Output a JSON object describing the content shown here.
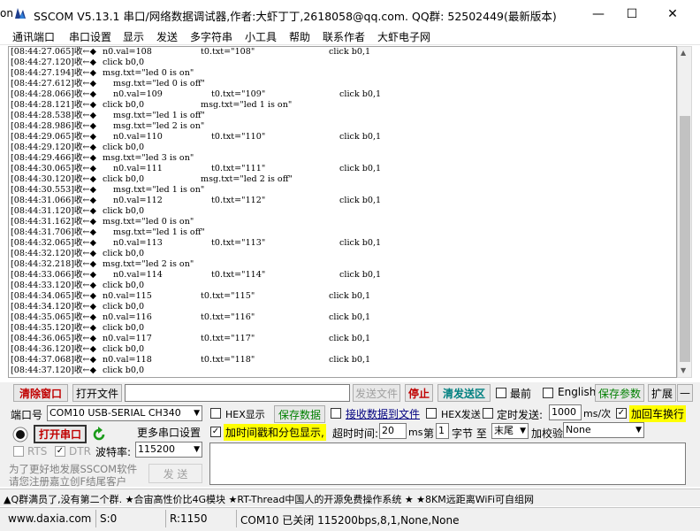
{
  "window": {
    "edge_text": "on",
    "title": "SSCOM V5.13.1 串口/网络数据调试器,作者:大虾丁丁,2618058@qq.com. QQ群: 52502449(最新版本)",
    "controls": {
      "minimize": "—",
      "maximize": "☐",
      "close": "✕"
    }
  },
  "menu": [
    "通讯端口",
    "串口设置",
    "显示",
    "发送",
    "多字符串",
    "小工具",
    "帮助",
    "联系作者",
    "大虾电子网"
  ],
  "log": [
    {
      "t": "[08:44:27.065]收←◆",
      "a": "n0.val=108",
      "b": "t0.txt=\"108\"",
      "c": "click b0,1",
      "ind": 0
    },
    {
      "t": "[08:44:27.120]收←◆",
      "a": "click b0,0",
      "b": "",
      "c": "",
      "ind": 0
    },
    {
      "t": "[08:44:27.194]收←◆",
      "a": "msg.txt=\"led 0 is on\"",
      "b": "",
      "c": "",
      "ind": 0
    },
    {
      "t": "[08:44:27.612]收←◆",
      "a": "msg.txt=\"led 0 is off\"",
      "b": "",
      "c": "",
      "ind": 1
    },
    {
      "t": "[08:44:28.066]收←◆",
      "a": "n0.val=109",
      "b": "t0.txt=\"109\"",
      "c": "click b0,1",
      "ind": 1
    },
    {
      "t": "[08:44:28.121]收←◆",
      "a": "click b0,0",
      "b": "msg.txt=\"led 1 is on\"",
      "c": "",
      "ind": 0
    },
    {
      "t": "[08:44:28.538]收←◆",
      "a": "msg.txt=\"led 1 is off\"",
      "b": "",
      "c": "",
      "ind": 1
    },
    {
      "t": "[08:44:28.986]收←◆",
      "a": "msg.txt=\"led 2 is on\"",
      "b": "",
      "c": "",
      "ind": 1
    },
    {
      "t": "[08:44:29.065]收←◆",
      "a": "n0.val=110",
      "b": "t0.txt=\"110\"",
      "c": "click b0,1",
      "ind": 1
    },
    {
      "t": "[08:44:29.120]收←◆",
      "a": "click b0,0",
      "b": "",
      "c": "",
      "ind": 0
    },
    {
      "t": "[08:44:29.466]收←◆",
      "a": "msg.txt=\"led 3 is on\"",
      "b": "",
      "c": "",
      "ind": 0
    },
    {
      "t": "[08:44:30.065]收←◆",
      "a": "n0.val=111",
      "b": "t0.txt=\"111\"",
      "c": "click b0,1",
      "ind": 1
    },
    {
      "t": "[08:44:30.120]收←◆",
      "a": "click b0,0",
      "b": "msg.txt=\"led 2 is off\"",
      "c": "",
      "ind": 0
    },
    {
      "t": "[08:44:30.553]收←◆",
      "a": "msg.txt=\"led 1 is on\"",
      "b": "",
      "c": "",
      "ind": 1
    },
    {
      "t": "[08:44:31.066]收←◆",
      "a": "n0.val=112",
      "b": "t0.txt=\"112\"",
      "c": "click b0,1",
      "ind": 1
    },
    {
      "t": "[08:44:31.120]收←◆",
      "a": "click b0,0",
      "b": "",
      "c": "",
      "ind": 0
    },
    {
      "t": "[08:44:31.162]收←◆",
      "a": "msg.txt=\"led 0 is on\"",
      "b": "",
      "c": "",
      "ind": 0
    },
    {
      "t": "[08:44:31.706]收←◆",
      "a": "msg.txt=\"led 1 is off\"",
      "b": "",
      "c": "",
      "ind": 1
    },
    {
      "t": "[08:44:32.065]收←◆",
      "a": "n0.val=113",
      "b": "t0.txt=\"113\"",
      "c": "click b0,1",
      "ind": 1
    },
    {
      "t": "[08:44:32.120]收←◆",
      "a": "click b0,0",
      "b": "",
      "c": "",
      "ind": 0
    },
    {
      "t": "[08:44:32.218]收←◆",
      "a": "msg.txt=\"led 2 is on\"",
      "b": "",
      "c": "",
      "ind": 0
    },
    {
      "t": "[08:44:33.066]收←◆",
      "a": "n0.val=114",
      "b": "t0.txt=\"114\"",
      "c": "click b0,1",
      "ind": 1
    },
    {
      "t": "[08:44:33.120]收←◆",
      "a": "click b0,0",
      "b": "",
      "c": "",
      "ind": 0
    },
    {
      "t": "[08:44:34.065]收←◆",
      "a": "n0.val=115",
      "b": "t0.txt=\"115\"",
      "c": "click b0,1",
      "ind": 0
    },
    {
      "t": "[08:44:34.120]收←◆",
      "a": "click b0,0",
      "b": "",
      "c": "",
      "ind": 0
    },
    {
      "t": "[08:44:35.065]收←◆",
      "a": "n0.val=116",
      "b": "t0.txt=\"116\"",
      "c": "click b0,1",
      "ind": 0
    },
    {
      "t": "[08:44:35.120]收←◆",
      "a": "click b0,0",
      "b": "",
      "c": "",
      "ind": 0
    },
    {
      "t": "[08:44:36.065]收←◆",
      "a": "n0.val=117",
      "b": "t0.txt=\"117\"",
      "c": "click b0,1",
      "ind": 0
    },
    {
      "t": "[08:44:36.120]收←◆",
      "a": "click b0,0",
      "b": "",
      "c": "",
      "ind": 0
    },
    {
      "t": "[08:44:37.068]收←◆",
      "a": "n0.val=118",
      "b": "t0.txt=\"118\"",
      "c": "click b0,1",
      "ind": 0
    },
    {
      "t": "[08:44:37.120]收←◆",
      "a": "click b0,0",
      "b": "",
      "c": "",
      "ind": 0
    }
  ],
  "toolbar": {
    "clear_window": "清除窗口",
    "open_file": "打开文件",
    "send_file": "发送文件",
    "stop": "停止",
    "clear_send": "清发送区",
    "latest_label": "最前",
    "english_label": "English",
    "save_params": "保存参数",
    "expand": "扩展",
    "collapse": "—"
  },
  "settings": {
    "port_label": "端口号",
    "port_value": "COM10 USB-SERIAL CH340",
    "hex_display_label": "HEX显示",
    "save_data": "保存数据",
    "recv_to_file_label": "接收数据到文件",
    "hex_send_label": "HEX发送",
    "timed_send_label": "定时发送:",
    "timed_value": "1000",
    "timed_unit": "ms/次",
    "append_newline_label": "加回车换行",
    "open_port": "打开串口",
    "more_settings": "更多串口设置",
    "timestamp_label": "加时间戳和分包显示,",
    "timeout_label": "超时时间:",
    "timeout_value": "20",
    "timeout_unit": "ms",
    "byte_label_pre": "第",
    "byte_value": "1",
    "byte_label_post": "字节 至",
    "end_value": "末尾",
    "checksum_label": "加校验",
    "checksum_value": "None",
    "rts_label": "RTS",
    "dtr_label": "DTR",
    "baud_label": "波特率:",
    "baud_value": "115200",
    "promo_line1": "为了更好地发展SSCOM软件",
    "promo_line2": "请您注册嘉立创F结尾客户",
    "send": "发 送"
  },
  "adbar": "▲Q群满员了,没有第二个群. ★合宙高性价比4G模块 ★RT-Thread中国人的开源免费操作系统 ★ ★8KM远距离WiFi可自组网",
  "status": {
    "website": "www.daxia.com",
    "sent": "S:0",
    "received": "R:1150",
    "port_state": "COM10 已关闭  115200bps,8,1,None,None"
  },
  "colors": {
    "accent_red": "#c00000",
    "accent_green": "#008000",
    "highlight_yellow": "#ffff00"
  }
}
